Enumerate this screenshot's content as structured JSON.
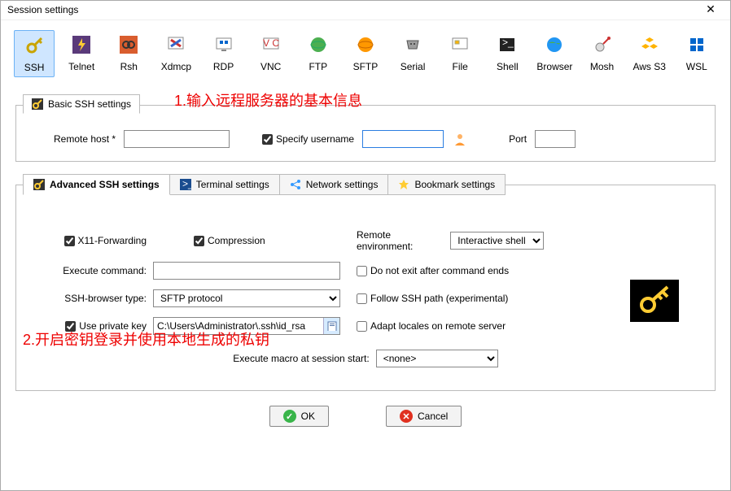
{
  "window": {
    "title": "Session settings"
  },
  "toolbar": {
    "items": [
      {
        "label": "SSH"
      },
      {
        "label": "Telnet"
      },
      {
        "label": "Rsh"
      },
      {
        "label": "Xdmcp"
      },
      {
        "label": "RDP"
      },
      {
        "label": "VNC"
      },
      {
        "label": "FTP"
      },
      {
        "label": "SFTP"
      },
      {
        "label": "Serial"
      },
      {
        "label": "File"
      },
      {
        "label": "Shell"
      },
      {
        "label": "Browser"
      },
      {
        "label": "Mosh"
      },
      {
        "label": "Aws S3"
      },
      {
        "label": "WSL"
      }
    ]
  },
  "basic_panel": {
    "tab_label": "Basic SSH settings",
    "remote_host_label": "Remote host *",
    "remote_host_value": "",
    "specify_username_label": "Specify username",
    "specify_username_checked": true,
    "username_value": "",
    "port_label": "Port",
    "port_value": ""
  },
  "adv_panel": {
    "tabs": [
      {
        "label": "Advanced SSH settings"
      },
      {
        "label": "Terminal settings"
      },
      {
        "label": "Network settings"
      },
      {
        "label": "Bookmark settings"
      }
    ],
    "x11_label": "X11-Forwarding",
    "compression_label": "Compression",
    "remote_env_label": "Remote environment:",
    "remote_env_value": "Interactive shell",
    "exec_cmd_label": "Execute command:",
    "exec_cmd_value": "",
    "do_not_exit_label": "Do not exit after command ends",
    "ssh_browser_label": "SSH-browser type:",
    "ssh_browser_value": "SFTP protocol",
    "follow_ssh_label": "Follow SSH path (experimental)",
    "use_private_key_label": "Use private key",
    "private_key_path": "C:\\Users\\Administrator\\.ssh\\id_rsa",
    "adapt_locales_label": "Adapt locales on remote server",
    "macro_label": "Execute macro at session start:",
    "macro_value": "<none>"
  },
  "annotations": {
    "a1": "1.输入远程服务器的基本信息",
    "a2": "2.开启密钥登录并使用本地生成的私钥"
  },
  "buttons": {
    "ok": "OK",
    "cancel": "Cancel"
  }
}
